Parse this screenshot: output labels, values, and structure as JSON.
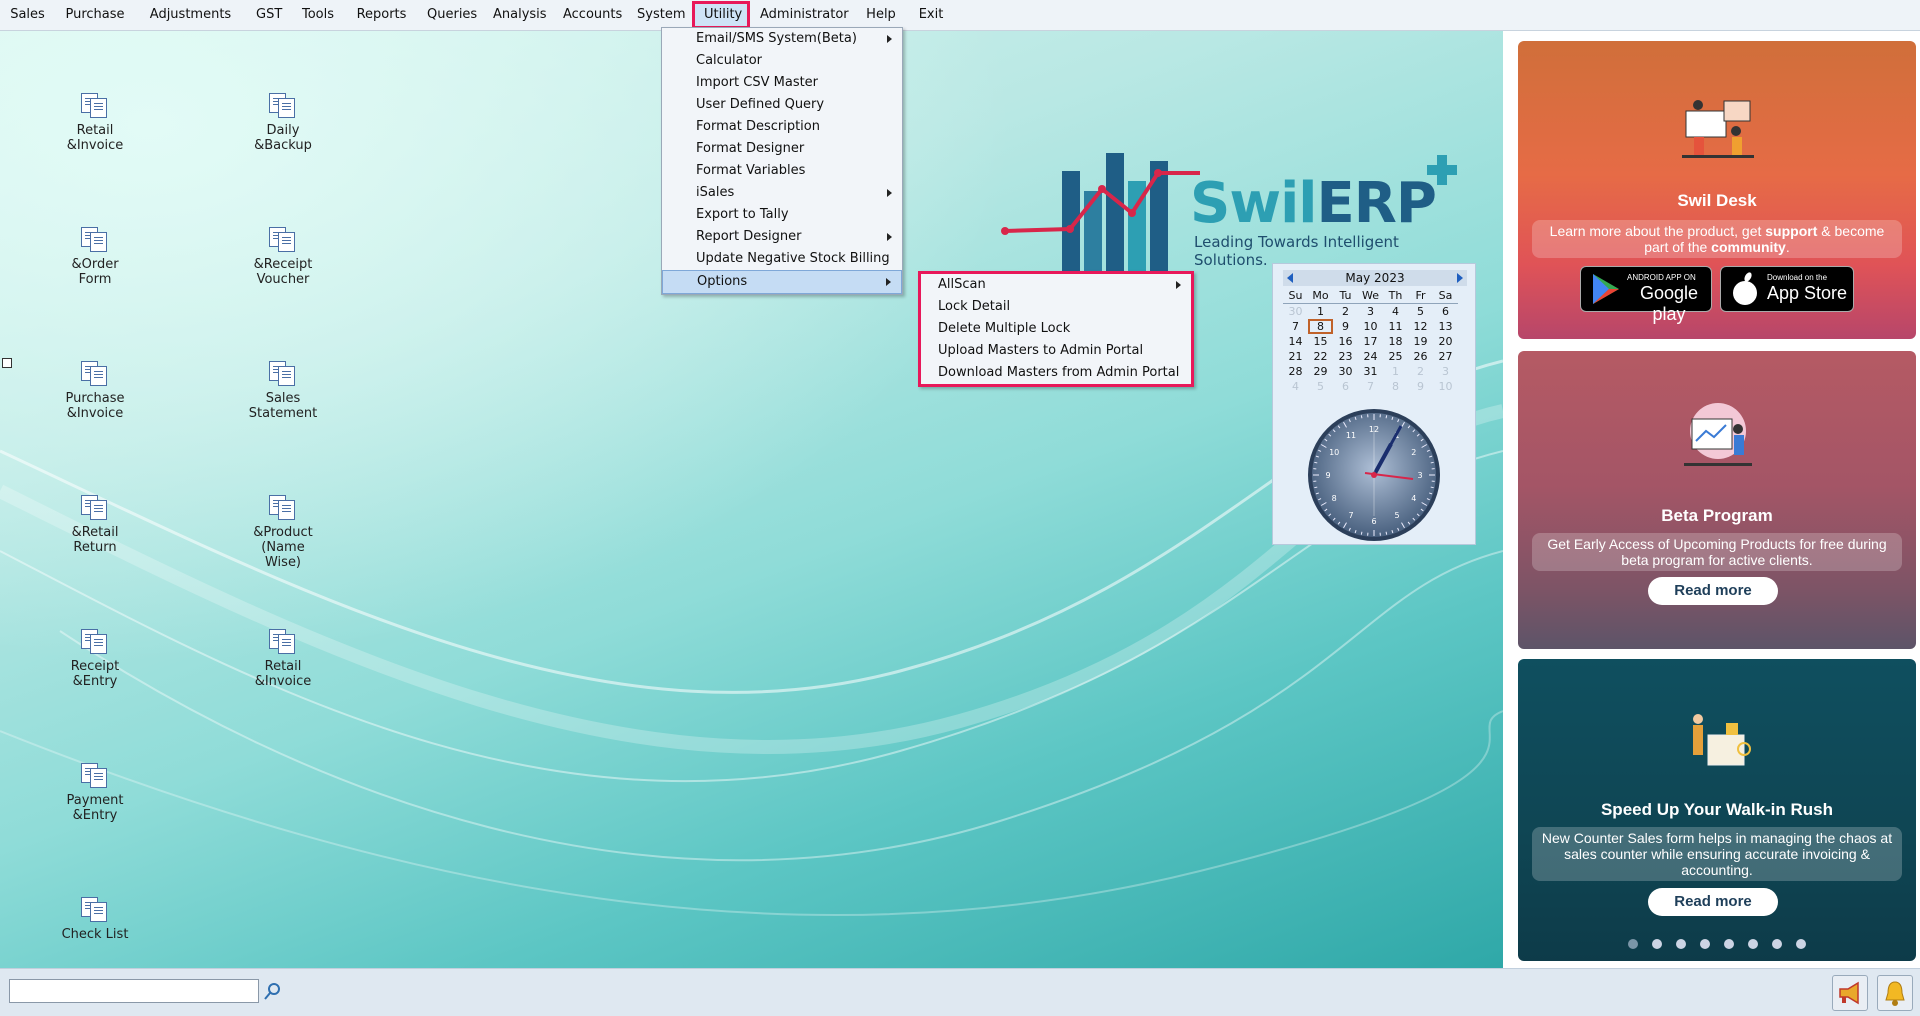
{
  "menubar": {
    "items": [
      "Sales",
      "Purchase",
      "Adjustments",
      "GST",
      "Tools",
      "Reports",
      "Queries",
      "Analysis",
      "Accounts",
      "System",
      "Utility",
      "Administrator",
      "Help",
      "Exit"
    ],
    "active": "Utility"
  },
  "desktop_icons": [
    "Retail\n&Invoice",
    "Daily\n&Backup",
    "&Order\nForm",
    "&Receipt\nVoucher",
    "Purchase\n&Invoice",
    "Sales\nStatement",
    "&Retail\nReturn",
    "&Product\n(Name\nWise)",
    "Receipt\n&Entry",
    "Retail\n&Invoice",
    "Payment\n&Entry",
    "Check List"
  ],
  "utility_menu": [
    {
      "label": "Email/SMS System(Beta)",
      "submenu": true
    },
    {
      "label": "Calculator",
      "submenu": false
    },
    {
      "label": "Import CSV Master",
      "submenu": false
    },
    {
      "label": "User Defined Query",
      "submenu": false
    },
    {
      "label": "Format Description",
      "submenu": false
    },
    {
      "label": "Format Designer",
      "submenu": false
    },
    {
      "label": "Format Variables",
      "submenu": false
    },
    {
      "label": "iSales",
      "submenu": true
    },
    {
      "label": "Export to Tally",
      "submenu": false
    },
    {
      "label": "Report Designer",
      "submenu": true
    },
    {
      "label": "Update Negative Stock Billing",
      "submenu": false
    },
    {
      "label": "Options",
      "submenu": true,
      "highlighted": true
    }
  ],
  "options_menu": [
    {
      "label": "AllScan",
      "submenu": true
    },
    {
      "label": "Lock Detail",
      "submenu": false
    },
    {
      "label": "Delete Multiple Lock",
      "submenu": false
    },
    {
      "label": "Upload Masters to Admin Portal",
      "submenu": false
    },
    {
      "label": "Download Masters from Admin Portal",
      "submenu": false
    }
  ],
  "logo": {
    "brand_a": "Swil",
    "brand_b": "ERP",
    "tagline": "Leading Towards Intelligent Solutions."
  },
  "calendar": {
    "month": "May",
    "year": "2023",
    "dow": [
      "Su",
      "Mo",
      "Tu",
      "We",
      "Th",
      "Fr",
      "Sa"
    ],
    "weeks": [
      [
        "30",
        "1",
        "2",
        "3",
        "4",
        "5",
        "6"
      ],
      [
        "7",
        "8",
        "9",
        "10",
        "11",
        "12",
        "13"
      ],
      [
        "14",
        "15",
        "16",
        "17",
        "18",
        "19",
        "20"
      ],
      [
        "21",
        "22",
        "23",
        "24",
        "25",
        "26",
        "27"
      ],
      [
        "28",
        "29",
        "30",
        "31",
        "1",
        "2",
        "3"
      ],
      [
        "4",
        "5",
        "6",
        "7",
        "8",
        "9",
        "10"
      ]
    ],
    "today": "8"
  },
  "clock": {
    "numbers": [
      "12",
      "1",
      "2",
      "3",
      "4",
      "5",
      "6",
      "7",
      "8",
      "9",
      "10",
      "11"
    ]
  },
  "cards": {
    "swil_desk": {
      "title": "Swil Desk",
      "desc_pre": "Learn more about the product, get ",
      "desc_b1": "support",
      "desc_mid": " & become part of the ",
      "desc_b2": "community",
      "desc_end": ".",
      "google_small": "ANDROID APP ON",
      "google_big": "Google play",
      "apple_small": "Download on the",
      "apple_big": "App Store"
    },
    "beta": {
      "title": "Beta Program",
      "desc": "Get Early Access of Upcoming Products for free during beta program for active clients.",
      "button": "Read more"
    },
    "rush": {
      "title": "Speed Up Your Walk-in Rush",
      "desc": "New Counter Sales form helps in managing the chaos at sales counter while ensuring accurate invoicing & accounting.",
      "button": "Read more"
    },
    "dots_count": 8,
    "active_dot": 0
  },
  "statusbar": {
    "search_value": ""
  },
  "colors": {
    "highlight_border": "#e8185a",
    "brand_teal": "#2d9fb3",
    "brand_navy": "#1f5e86",
    "chart_red": "#d8264a"
  }
}
